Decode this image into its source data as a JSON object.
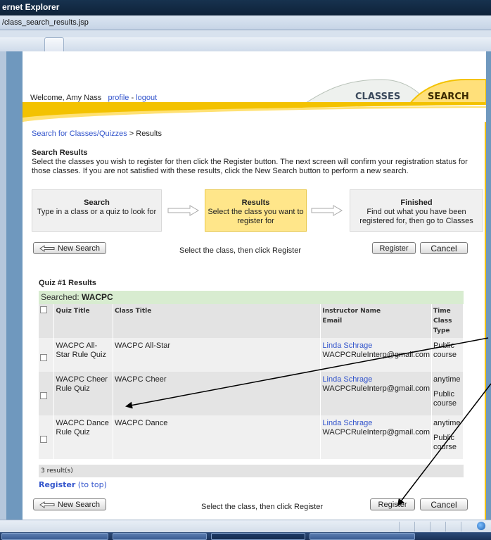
{
  "window": {
    "title": "ernet Explorer",
    "address": "/class_search_results.jsp"
  },
  "header": {
    "welcome": "Welcome, Amy Nass",
    "profile_link": "profile",
    "separator": "-",
    "logout_link": "logout",
    "tab_classes": "CLASSES",
    "tab_search": "SEARCH"
  },
  "breadcrumb": {
    "link": "Search for Classes/Quizzes",
    "current": "> Results"
  },
  "search_results": {
    "title": "Search Results",
    "description": "Select the classes you wish to register for then click the Register button. The next screen will confirm your registration status for those classes. If you are not satisfied with these results, click the New Search button to perform a new search."
  },
  "steps": [
    {
      "title": "Search",
      "text": "Type in a class or a quiz to look for"
    },
    {
      "title": "Results",
      "text": "Select the class you want to register for"
    },
    {
      "title": "Finished",
      "text": "Find out what you have been registered for, then go to Classes"
    }
  ],
  "actions": {
    "new_search": "New Search",
    "hint": "Select the class, then click Register",
    "register": "Register",
    "cancel": "Cancel"
  },
  "quiz": {
    "title": "Quiz #1 Results",
    "searched_label": "Searched:",
    "searched_term": "WACPC",
    "columns": {
      "quiz_title": "Quiz Title",
      "class_title": "Class Title",
      "instructor": "Instructor Name",
      "email": "Email",
      "time": "Time",
      "class_type": "Class Type"
    },
    "rows": [
      {
        "quiz": "WACPC All-Star Rule Quiz",
        "class": "WACPC All-Star",
        "instructor": "Linda Schrage",
        "email": "WACPCRuleInterp@gmail.com",
        "time": "",
        "type": "Public course"
      },
      {
        "quiz": "WACPC Cheer Rule Quiz",
        "class": "WACPC Cheer",
        "instructor": "Linda Schrage",
        "email": "WACPCRuleInterp@gmail.com",
        "time": "anytime",
        "type": "Public course"
      },
      {
        "quiz": "WACPC Dance Rule Quiz",
        "class": "WACPC Dance",
        "instructor": "Linda Schrage",
        "email": "WACPCRuleInterp@gmail.com",
        "time": "anytime",
        "type": "Public course"
      }
    ],
    "count": "3 result(s)",
    "register_link": "Register",
    "to_top": "(to top)"
  },
  "colors": {
    "accent_yellow": "#f3c200",
    "link_blue": "#3355cc",
    "searched_bg": "#d8ecd0"
  }
}
